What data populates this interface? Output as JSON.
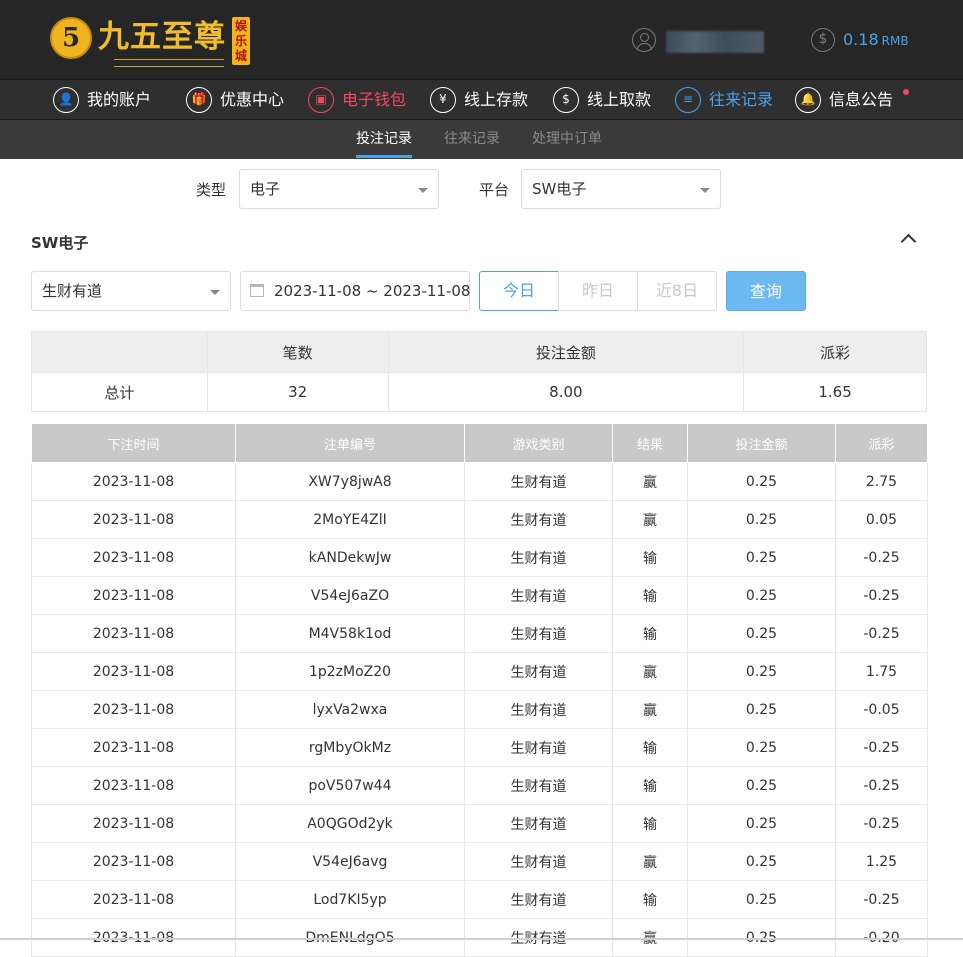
{
  "brand": {
    "logo_glyph": "5",
    "name": "九五至尊",
    "badge": "娱乐城"
  },
  "account": {
    "balance": "0.18",
    "currency": "RMB",
    "coin_symbol": "$"
  },
  "nav": {
    "items": [
      {
        "label": "我的账户",
        "icon": "user-icon",
        "glyph": "👤"
      },
      {
        "label": "优惠中心",
        "icon": "gift-icon",
        "glyph": "🎁"
      },
      {
        "label": "电子钱包",
        "icon": "wallet-icon",
        "glyph": "▣"
      },
      {
        "label": "线上存款",
        "icon": "deposit-icon",
        "glyph": "¥"
      },
      {
        "label": "线上取款",
        "icon": "withdraw-icon",
        "glyph": "$"
      },
      {
        "label": "往来记录",
        "icon": "records-icon",
        "glyph": "≡"
      },
      {
        "label": "信息公告",
        "icon": "bell-icon",
        "glyph": "🔔"
      }
    ]
  },
  "subnav": {
    "tabs": [
      "投注记录",
      "往来记录",
      "处理中订单"
    ]
  },
  "filters": {
    "type_label": "类型",
    "type_value": "电子",
    "platform_label": "平台",
    "platform_value": "SW电子"
  },
  "section": {
    "title": "SW电子"
  },
  "query": {
    "game_value": "生财有道",
    "date_range": "2023-11-08 ~ 2023-11-08",
    "quick": [
      "今日",
      "昨日",
      "近8日"
    ],
    "button": "查询"
  },
  "summary": {
    "headers": [
      "",
      "笔数",
      "投注金额",
      "派彩"
    ],
    "row": [
      "总计",
      "32",
      "8.00",
      "1.65"
    ]
  },
  "table": {
    "headers": [
      "下注时间",
      "注单编号",
      "游戏类别",
      "结果",
      "投注金额",
      "派彩"
    ],
    "rows": [
      [
        "2023-11-08",
        "XW7y8jwA8",
        "生财有道",
        "赢",
        "0.25",
        "2.75"
      ],
      [
        "2023-11-08",
        "2MoYE4ZlI",
        "生财有道",
        "赢",
        "0.25",
        "0.05"
      ],
      [
        "2023-11-08",
        "kANDekwJw",
        "生财有道",
        "输",
        "0.25",
        "-0.25"
      ],
      [
        "2023-11-08",
        "V54eJ6aZO",
        "生财有道",
        "输",
        "0.25",
        "-0.25"
      ],
      [
        "2023-11-08",
        "M4V58k1od",
        "生财有道",
        "输",
        "0.25",
        "-0.25"
      ],
      [
        "2023-11-08",
        "1p2zMoZ20",
        "生财有道",
        "赢",
        "0.25",
        "1.75"
      ],
      [
        "2023-11-08",
        "lyxVa2wxa",
        "生财有道",
        "赢",
        "0.25",
        "-0.05"
      ],
      [
        "2023-11-08",
        "rgMbyOkMz",
        "生财有道",
        "输",
        "0.25",
        "-0.25"
      ],
      [
        "2023-11-08",
        "poV507w44",
        "生财有道",
        "输",
        "0.25",
        "-0.25"
      ],
      [
        "2023-11-08",
        "A0QGOd2yk",
        "生财有道",
        "输",
        "0.25",
        "-0.25"
      ],
      [
        "2023-11-08",
        "V54eJ6avg",
        "生财有道",
        "赢",
        "0.25",
        "1.25"
      ],
      [
        "2023-11-08",
        "Lod7KI5yp",
        "生财有道",
        "输",
        "0.25",
        "-0.25"
      ],
      [
        "2023-11-08",
        "DmENLdgO5",
        "生财有道",
        "赢",
        "0.25",
        "-0.20"
      ]
    ]
  },
  "colors": {
    "accent": "#4aa3e8",
    "negative": "#f04a5f",
    "brand_gold": "#f2bd2c"
  }
}
